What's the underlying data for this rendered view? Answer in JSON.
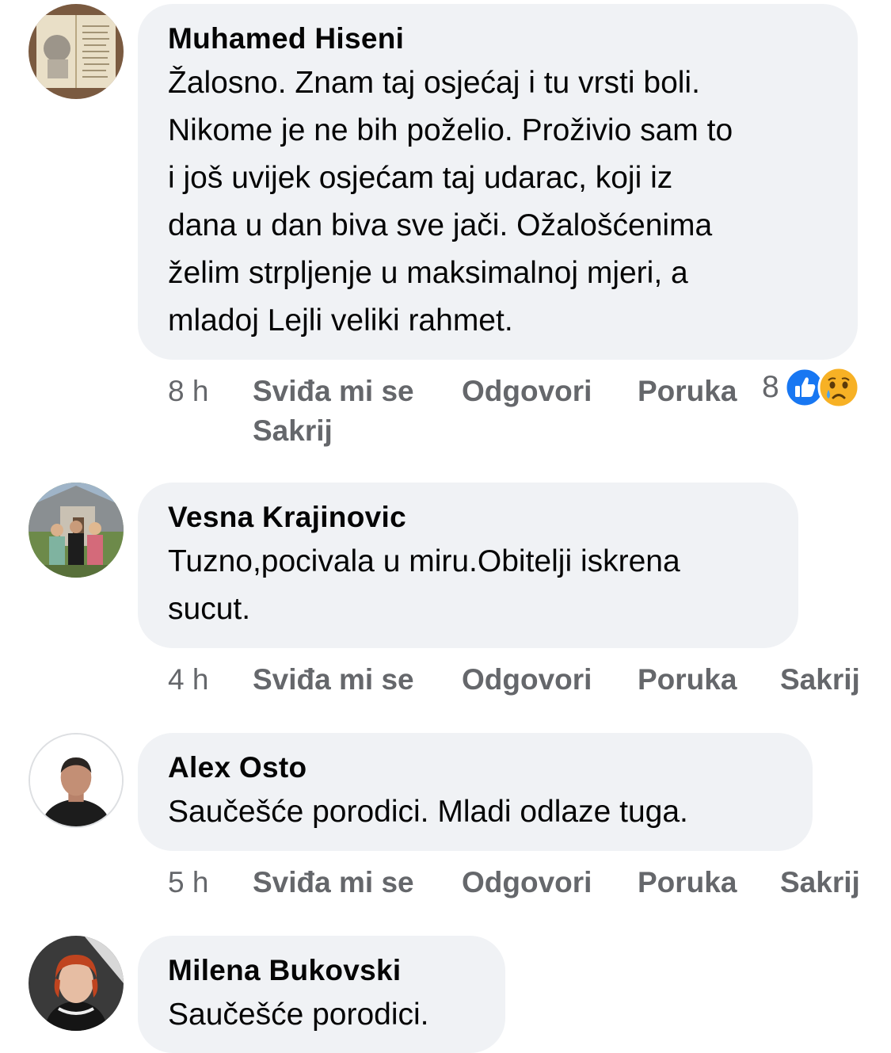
{
  "comments": [
    {
      "author": "Muhamed Hiseni",
      "text": [
        "Žalosno. Znam taj osjećaj i tu vrsti boli.",
        "Nikome je ne bih poželio. Proživio sam to",
        "i još uvijek osjećam taj udarac, koji iz",
        "dana u dan biva sve jači. Ožalošćenima",
        "želim strpljenje u maksimalnoj mjeri, a",
        "mladoj Lejli veliki rahmet."
      ],
      "time": "8 h",
      "like": "Sviđa mi se",
      "reply": "Odgovori",
      "message": "Poruka",
      "hide": "Sakrij",
      "reaction_count": "8",
      "reaction_icons": [
        "like-icon",
        "sad-icon"
      ]
    },
    {
      "author": "Vesna Krajinovic",
      "text": [
        "Tuzno,pocivala u miru.Obitelji iskrena",
        "sucut."
      ],
      "time": "4 h",
      "like": "Sviđa mi se",
      "reply": "Odgovori",
      "message": "Poruka",
      "hide": "Sakrij"
    },
    {
      "author": "Alex Osto",
      "text": [
        "Saučešće porodici. Mladi odlaze tuga."
      ],
      "time": "5 h",
      "like": "Sviđa mi se",
      "reply": "Odgovori",
      "message": "Poruka",
      "hide": "Sakrij"
    },
    {
      "author": "Milena Bukovski",
      "text": [
        "Saučešće porodici."
      ]
    }
  ],
  "colors": {
    "bubble": "#f0f2f5",
    "secondary_text": "#65676b",
    "like_blue": "#1877f2",
    "sad_yellow": "#f7b125"
  }
}
